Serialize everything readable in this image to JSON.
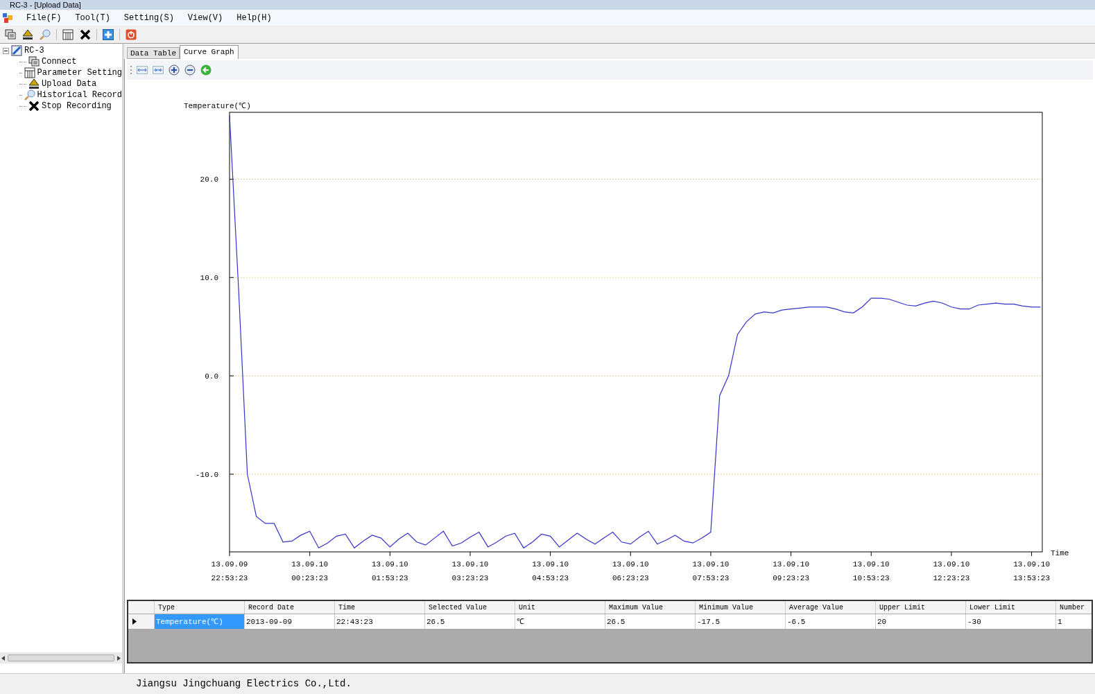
{
  "window": {
    "title": "RC-3 - [Upload Data]"
  },
  "menu": [
    "File(F)",
    "Tool(T)",
    "Setting(S)",
    "View(V)",
    "Help(H)"
  ],
  "toolbar": [
    {
      "kind": "connect"
    },
    {
      "kind": "upload"
    },
    {
      "kind": "history"
    },
    {
      "kind": "sep"
    },
    {
      "kind": "grid"
    },
    {
      "kind": "stop"
    },
    {
      "kind": "sep"
    },
    {
      "kind": "add"
    },
    {
      "kind": "sep"
    },
    {
      "kind": "power"
    }
  ],
  "tree": {
    "label": "RC-3",
    "expanded": true,
    "children": [
      {
        "label": "Connect",
        "kind": "connect"
      },
      {
        "label": "Parameter Setting",
        "kind": "grid"
      },
      {
        "label": "Upload Data",
        "kind": "upload"
      },
      {
        "label": "Historical Record",
        "kind": "history"
      },
      {
        "label": "Stop Recording",
        "kind": "stop"
      }
    ]
  },
  "tabs": [
    {
      "label": "Data Table",
      "selected": false
    },
    {
      "label": "Curve Graph",
      "selected": true
    }
  ],
  "graph_toolbar": [
    {
      "kind": "expand"
    },
    {
      "kind": "shrink"
    },
    {
      "kind": "zoom_in"
    },
    {
      "kind": "zoom_out"
    },
    {
      "kind": "back"
    }
  ],
  "chart_data": {
    "type": "line",
    "ylabel": "Temperature(℃)",
    "xlabel": "Time",
    "categories": [
      "13.09.09 22:53:23",
      null,
      null,
      null,
      null,
      null,
      null,
      null,
      null,
      "13.09.10 00:23:23",
      null,
      null,
      null,
      null,
      null,
      null,
      null,
      null,
      "13.09.10 01:53:23",
      null,
      null,
      null,
      null,
      null,
      null,
      null,
      null,
      "13.09.10 03:23:23",
      null,
      null,
      null,
      null,
      null,
      null,
      null,
      null,
      "13.09.10 04:53:23",
      null,
      null,
      null,
      null,
      null,
      null,
      null,
      null,
      "13.09.10 06:23:23",
      null,
      null,
      null,
      null,
      null,
      null,
      null,
      null,
      "13.09.10 07:53:23",
      null,
      null,
      null,
      null,
      null,
      null,
      null,
      null,
      "13.09.10 09:23:23",
      null,
      null,
      null,
      null,
      null,
      null,
      null,
      null,
      "13.09.10 10:53:23",
      null,
      null,
      null,
      null,
      null,
      null,
      null,
      null,
      "13.09.10 12:23:23",
      null,
      null,
      null,
      null,
      null,
      null,
      null,
      null,
      "13.09.10 13:53:23",
      null
    ],
    "series": [
      {
        "color": "#3333cc",
        "values": [
          26.5,
          9,
          -10,
          -14.3,
          -15,
          -15,
          -16.9,
          -16.8,
          -16.2,
          -15.8,
          -17.5,
          -17,
          -16.3,
          -16.1,
          -17.5,
          -16.8,
          -16.2,
          -16.5,
          -17.4,
          -16.6,
          -16,
          -16.9,
          -17.2,
          -16.5,
          -15.8,
          -17.3,
          -17,
          -16.4,
          -15.9,
          -17.4,
          -16.9,
          -16.3,
          -16,
          -17.5,
          -16.9,
          -16.1,
          -16.3,
          -17.4,
          -16.7,
          -16,
          -16.6,
          -17.1,
          -16.5,
          -15.9,
          -16.9,
          -17.1,
          -16.4,
          -15.8,
          -17.1,
          -16.7,
          -16.2,
          -16.8,
          -17,
          -16.5,
          -15.9,
          -2,
          0,
          4.2,
          5.5,
          6.3,
          6.5,
          6.4,
          6.7,
          6.8,
          6.9,
          7,
          7,
          7,
          6.8,
          6.5,
          6.4,
          7,
          7.9,
          7.9,
          7.8,
          7.5,
          7.2,
          7.1,
          7.4,
          7.6,
          7.4,
          7,
          6.8,
          6.8,
          7.2,
          7.3,
          7.4,
          7.3,
          7.3,
          7.1,
          7,
          7
        ]
      }
    ],
    "ylim": [
      -17.9,
      26.8
    ],
    "grid": true,
    "yticks": [
      {
        "value": -10,
        "label": "-10.0"
      },
      {
        "value": 0,
        "label": "0.0"
      },
      {
        "value": 10,
        "label": "10.0"
      },
      {
        "value": 20,
        "label": "20.0"
      }
    ]
  },
  "table": {
    "columns": [
      "Type",
      "Record Date",
      "Time",
      "Selected Value",
      "Unit",
      "Maximum Value",
      "Minimum Value",
      "Average Value",
      "Upper Limit",
      "Lower Limit",
      "Number"
    ],
    "rows": [
      {
        "selected": true,
        "cells": [
          "Temperature(℃)",
          "2013-09-09",
          "22:43:23",
          "26.5",
          "℃",
          "26.5",
          "-17.5",
          "-6.5",
          "20",
          "-30",
          "1"
        ]
      }
    ]
  },
  "status_bar": "Jiangsu Jingchuang Electrics Co.,Ltd."
}
